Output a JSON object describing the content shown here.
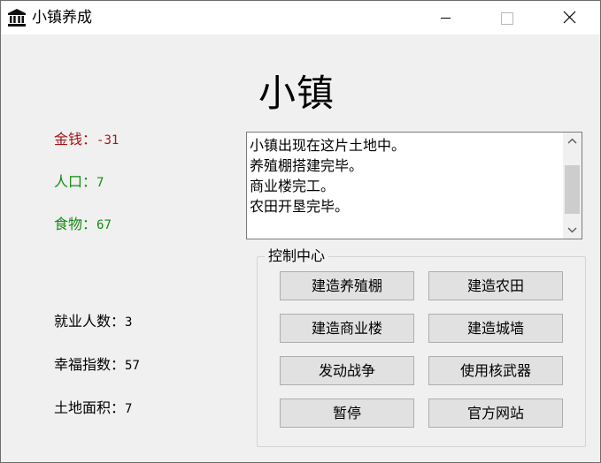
{
  "window": {
    "title": "小镇养成",
    "app_icon": "bank-building-icon"
  },
  "titlebar_buttons": {
    "minimize": "minimize-icon",
    "maximize": "maximize-icon",
    "close": "close-icon"
  },
  "main": {
    "heading": "小镇"
  },
  "stats": {
    "money": {
      "label": "金钱：",
      "value": "-31",
      "color": "#a81212"
    },
    "population": {
      "label": "人口：",
      "value": "7",
      "color": "#138a13"
    },
    "food": {
      "label": "食物：",
      "value": "67",
      "color": "#138a13"
    },
    "employed": {
      "label": "就业人数：",
      "value": "3"
    },
    "happiness": {
      "label": "幸福指数：",
      "value": "57"
    },
    "land_area": {
      "label": "土地面积：",
      "value": "7"
    }
  },
  "log": {
    "lines": [
      "小镇出现在这片土地中。",
      "养殖棚搭建完毕。",
      "商业楼完工。",
      "农田开垦完毕。"
    ]
  },
  "control": {
    "title": "控制中心",
    "buttons": {
      "build_farm_shed": "建造养殖棚",
      "build_farmland": "建造农田",
      "build_commercial": "建造商业楼",
      "build_wall": "建造城墙",
      "start_war": "发动战争",
      "use_nuke": "使用核武器",
      "pause": "暂停",
      "official_site": "官方网站"
    }
  }
}
